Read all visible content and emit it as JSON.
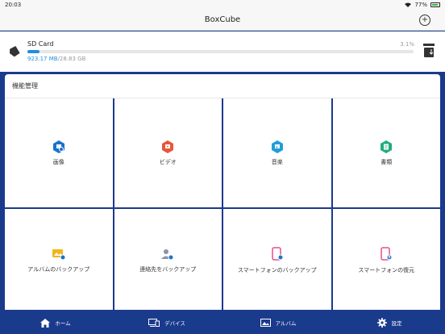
{
  "status": {
    "time": "20:03",
    "battery": "77%"
  },
  "nav": {
    "title": "BoxCube",
    "add_icon": "+"
  },
  "storage": {
    "name": "SD Card",
    "percent": "3.1%",
    "used": "923.17 MB",
    "separator": "/",
    "total": "28.83 GB",
    "used_fraction": 0.031
  },
  "section": {
    "title": "機能管理"
  },
  "tiles": [
    {
      "label": "画像",
      "icon": "image-icon",
      "color": "#1a73c8"
    },
    {
      "label": "ビデオ",
      "icon": "video-icon",
      "color": "#e8563a"
    },
    {
      "label": "音楽",
      "icon": "music-icon",
      "color": "#1e9fd8"
    },
    {
      "label": "書類",
      "icon": "document-icon",
      "color": "#1fae7c"
    },
    {
      "label": "アルバムのバックアップ",
      "icon": "album-backup-icon",
      "color": "#f2b51b"
    },
    {
      "label": "連絡先をバックアップ",
      "icon": "contacts-backup-icon",
      "color": "#8a93a6"
    },
    {
      "label": "スマートフォンのバックアップ",
      "icon": "phone-backup-icon",
      "color": "#e84d8a"
    },
    {
      "label": "スマートフォンの復元",
      "icon": "phone-restore-icon",
      "color": "#e84d8a"
    }
  ],
  "tabs": [
    {
      "label": "ホーム",
      "icon": "home-icon"
    },
    {
      "label": "デバイス",
      "icon": "devices-icon"
    },
    {
      "label": "アルバム",
      "icon": "album-icon"
    },
    {
      "label": "設定",
      "icon": "settings-icon"
    }
  ]
}
